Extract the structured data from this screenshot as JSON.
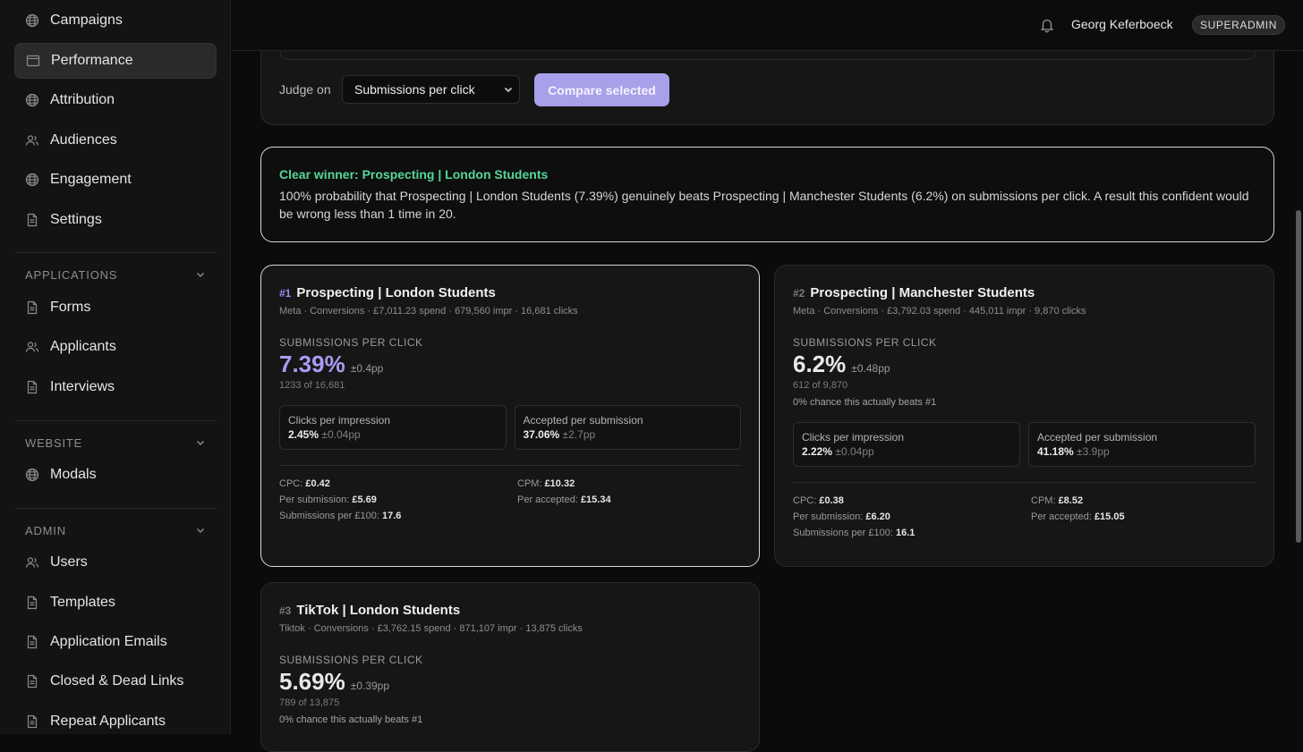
{
  "sidebar": {
    "main_items": [
      {
        "label": "Campaigns",
        "icon": "globe-icon"
      },
      {
        "label": "Performance",
        "icon": "window-icon",
        "active": true
      },
      {
        "label": "Attribution",
        "icon": "globe-icon"
      },
      {
        "label": "Audiences",
        "icon": "users-icon"
      },
      {
        "label": "Engagement",
        "icon": "globe-icon"
      },
      {
        "label": "Settings",
        "icon": "file-icon"
      }
    ],
    "applications": {
      "heading": "APPLICATIONS",
      "items": [
        {
          "label": "Forms",
          "icon": "file-icon"
        },
        {
          "label": "Applicants",
          "icon": "users-icon"
        },
        {
          "label": "Interviews",
          "icon": "file-icon"
        }
      ]
    },
    "website": {
      "heading": "WEBSITE",
      "items": [
        {
          "label": "Modals",
          "icon": "globe-icon"
        }
      ]
    },
    "admin": {
      "heading": "ADMIN",
      "items": [
        {
          "label": "Users",
          "icon": "users-icon"
        },
        {
          "label": "Templates",
          "icon": "file-icon"
        },
        {
          "label": "Application Emails",
          "icon": "file-icon"
        },
        {
          "label": "Closed & Dead Links",
          "icon": "file-icon"
        },
        {
          "label": "Repeat Applicants",
          "icon": "file-icon"
        }
      ]
    }
  },
  "header": {
    "user_name": "Georg Keferboeck",
    "role": "SUPERADMIN"
  },
  "compare": {
    "judge_label": "Judge on",
    "judge_value": "Submissions per click",
    "compare_button": "Compare selected"
  },
  "winner": {
    "title": "Clear winner: Prospecting | London Students",
    "text": "100% probability that Prospecting | London Students (7.39%) genuinely beats Prospecting | Manchester Students (6.2%) on submissions per click. A result this confident would be wrong less than 1 time in 20.",
    "color": "#56d69a"
  },
  "cards": [
    {
      "rank": "#1",
      "name": "Prospecting | London Students",
      "meta": "Meta · Conversions · £7,011.23 spend · 679,560 impr · 16,681 clicks",
      "metric_label": "SUBMISSIONS PER CLICK",
      "metric_value": "7.39%",
      "metric_pm": "±0.4pp",
      "metric_of": "1233 of 16,681",
      "chance": "",
      "cpi_label": "Clicks per impression",
      "cpi_value": "2.45%",
      "cpi_pm": "±0.04pp",
      "aps_label": "Accepted per submission",
      "aps_value": "37.06%",
      "aps_pm": "±2.7pp",
      "cpc_label": "CPC:",
      "cpc": "£0.42",
      "cpm_label": "CPM:",
      "cpm": "£10.32",
      "per_sub_label": "Per submission:",
      "per_sub": "£5.69",
      "per_acc_label": "Per accepted:",
      "per_acc": "£15.34",
      "subs_100_label": "Submissions per £100:",
      "subs_100": "17.6"
    },
    {
      "rank": "#2",
      "name": "Prospecting | Manchester Students",
      "meta": "Meta · Conversions · £3,792.03 spend · 445,011 impr · 9,870 clicks",
      "metric_label": "SUBMISSIONS PER CLICK",
      "metric_value": "6.2%",
      "metric_pm": "±0.48pp",
      "metric_of": "612 of 9,870",
      "chance": "0% chance this actually beats #1",
      "cpi_label": "Clicks per impression",
      "cpi_value": "2.22%",
      "cpi_pm": "±0.04pp",
      "aps_label": "Accepted per submission",
      "aps_value": "41.18%",
      "aps_pm": "±3.9pp",
      "cpc_label": "CPC:",
      "cpc": "£0.38",
      "cpm_label": "CPM:",
      "cpm": "£8.52",
      "per_sub_label": "Per submission:",
      "per_sub": "£6.20",
      "per_acc_label": "Per accepted:",
      "per_acc": "£15.05",
      "subs_100_label": "Submissions per £100:",
      "subs_100": "16.1"
    },
    {
      "rank": "#3",
      "name": "TikTok | London Students",
      "meta": "Tiktok · Conversions · £3,762.15 spend · 871,107 impr · 13,875 clicks",
      "metric_label": "SUBMISSIONS PER CLICK",
      "metric_value": "5.69%",
      "metric_pm": "±0.39pp",
      "metric_of": "789 of 13,875",
      "chance": "0% chance this actually beats #1"
    }
  ],
  "colors": {
    "accent": "#a8a0e8",
    "winner_green": "#56d69a",
    "background": "#0b0b0b"
  }
}
